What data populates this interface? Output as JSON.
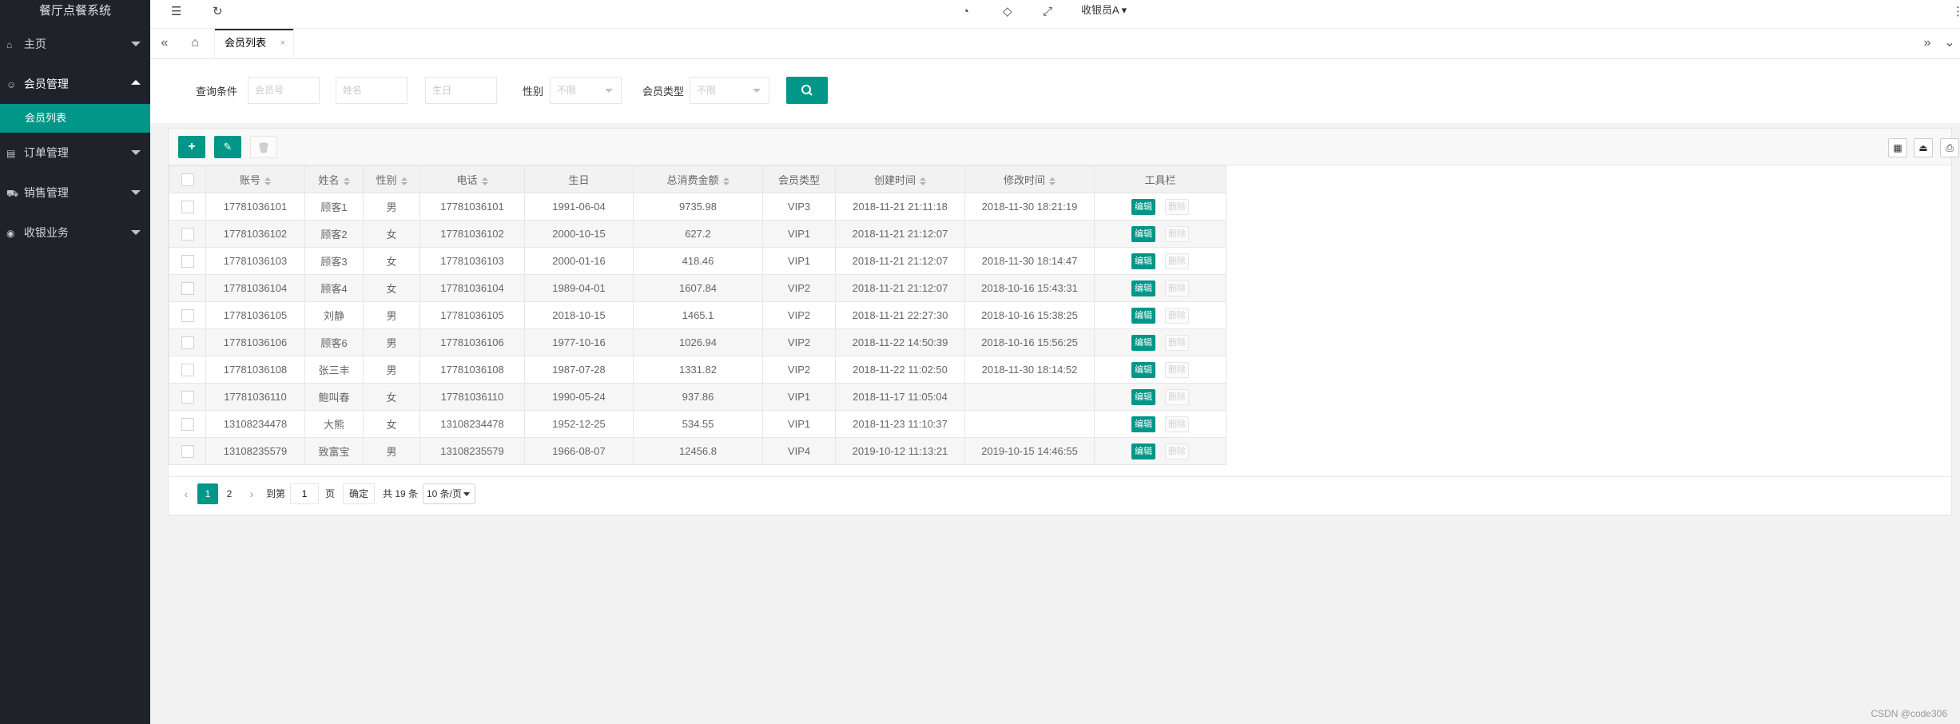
{
  "sidebar": {
    "logo": "餐厅点餐系统",
    "items": [
      {
        "label": "主页",
        "icon": "home-icon"
      },
      {
        "label": "会员管理",
        "icon": "user-icon",
        "open": true,
        "children": [
          {
            "label": "会员列表"
          }
        ]
      },
      {
        "label": "订单管理",
        "icon": "order-icon"
      },
      {
        "label": "销售管理",
        "icon": "cart-icon"
      },
      {
        "label": "收银业务",
        "icon": "cashier-icon"
      }
    ]
  },
  "header": {
    "user": "收银员A"
  },
  "tabs": {
    "active": "会员列表",
    "close": "×"
  },
  "query": {
    "label": "查询条件",
    "account_placeholder": "会员号",
    "name_placeholder": "姓名",
    "birthday_placeholder": "生日",
    "gender_label": "性别",
    "gender_value": "不限",
    "type_label": "会员类型",
    "type_value": "不限"
  },
  "toolbar": {
    "add": "+",
    "edit": "✎",
    "delete": "🗑"
  },
  "table": {
    "columns": [
      "账号",
      "姓名",
      "性别",
      "电话",
      "生日",
      "总消费金额",
      "会员类型",
      "创建时间",
      "修改时间",
      "工具栏"
    ],
    "edit_label": "编辑",
    "delete_label": "删除",
    "rows": [
      [
        "17781036101",
        "顾客1",
        "男",
        "17781036101",
        "1991-06-04",
        "9735.98",
        "VIP3",
        "2018-11-21 21:11:18",
        "2018-11-30 18:21:19"
      ],
      [
        "17781036102",
        "顾客2",
        "女",
        "17781036102",
        "2000-10-15",
        "627.2",
        "VIP1",
        "2018-11-21 21:12:07",
        ""
      ],
      [
        "17781036103",
        "顾客3",
        "女",
        "17781036103",
        "2000-01-16",
        "418.46",
        "VIP1",
        "2018-11-21 21:12:07",
        "2018-11-30 18:14:47"
      ],
      [
        "17781036104",
        "顾客4",
        "女",
        "17781036104",
        "1989-04-01",
        "1607.84",
        "VIP2",
        "2018-11-21 21:12:07",
        "2018-10-16 15:43:31"
      ],
      [
        "17781036105",
        "刘静",
        "男",
        "17781036105",
        "2018-10-15",
        "1465.1",
        "VIP2",
        "2018-11-21 22:27:30",
        "2018-10-16 15:38:25"
      ],
      [
        "17781036106",
        "顾客6",
        "男",
        "17781036106",
        "1977-10-16",
        "1026.94",
        "VIP2",
        "2018-11-22 14:50:39",
        "2018-10-16 15:56:25"
      ],
      [
        "17781036108",
        "张三丰",
        "男",
        "17781036108",
        "1987-07-28",
        "1331.82",
        "VIP2",
        "2018-11-22 11:02:50",
        "2018-11-30 18:14:52"
      ],
      [
        "17781036110",
        "鲍叫春",
        "女",
        "17781036110",
        "1990-05-24",
        "937.86",
        "VIP1",
        "2018-11-17 11:05:04",
        ""
      ],
      [
        "13108234478",
        "大熊",
        "女",
        "13108234478",
        "1952-12-25",
        "534.55",
        "VIP1",
        "2018-11-23 11:10:37",
        ""
      ],
      [
        "13108235579",
        "致富宝",
        "男",
        "13108235579",
        "1966-08-07",
        "12456.8",
        "VIP4",
        "2019-10-12 11:13:21",
        "2019-10-15 14:46:55"
      ]
    ]
  },
  "pager": {
    "prev": "‹",
    "current": "1",
    "page2": "2",
    "next": "›",
    "goto_label": "到第",
    "goto_value": "1",
    "page_unit": "页",
    "confirm": "确定",
    "total": "共 19 条",
    "per_page": "10 条/页"
  },
  "watermark": "CSDN @code306",
  "colors": {
    "accent": "#009688",
    "sidebar": "#20222a"
  }
}
